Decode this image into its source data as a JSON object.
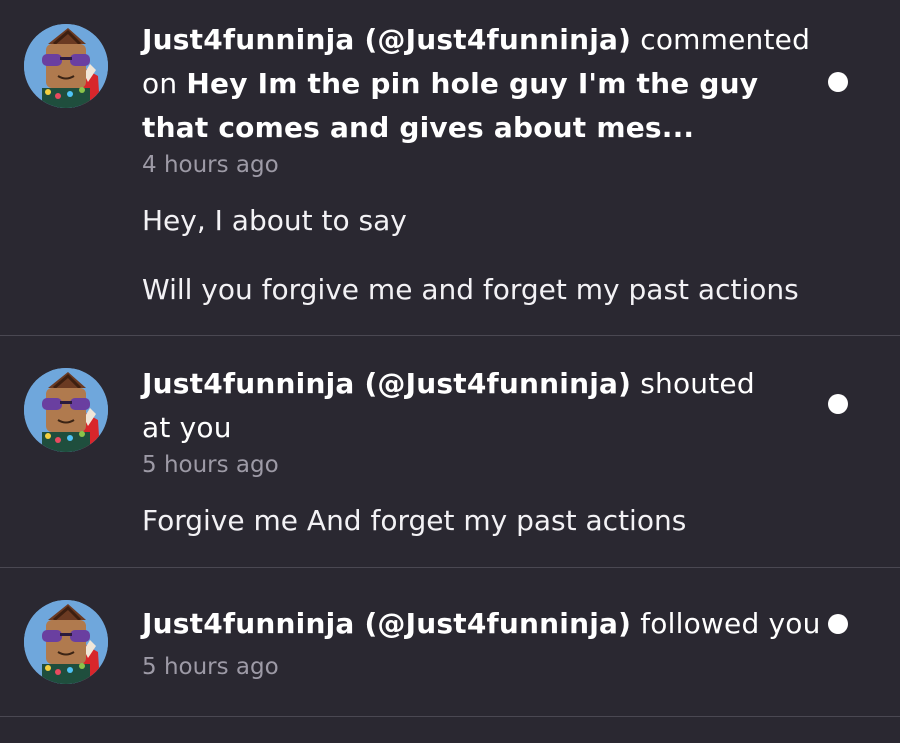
{
  "notifications": [
    {
      "user": "Just4funninja (@Just4funninja)",
      "verb": "commented on",
      "target": "Hey Im the pin hole guy I'm the guy that comes and gives about mes...",
      "time": "4 hours ago",
      "messages": [
        "Hey, I about to say",
        "Will you forgive me and forget my past actions"
      ],
      "unread": true
    },
    {
      "user": "Just4funninja (@Just4funninja)",
      "verb": "shouted at you",
      "target": "",
      "time": "5 hours ago",
      "messages": [
        "Forgive me And forget my past actions"
      ],
      "unread": true
    },
    {
      "user": "Just4funninja (@Just4funninja)",
      "verb": "followed you",
      "target": "",
      "time": "5 hours ago",
      "messages": [],
      "unread": true
    }
  ],
  "colors": {
    "background": "#2a2831",
    "divider": "#4a4852",
    "muted_text": "#9d9aa6",
    "unread_dot": "#ffffff"
  },
  "icons": {
    "avatar": "user-avatar",
    "unread": "unread-dot-icon"
  }
}
